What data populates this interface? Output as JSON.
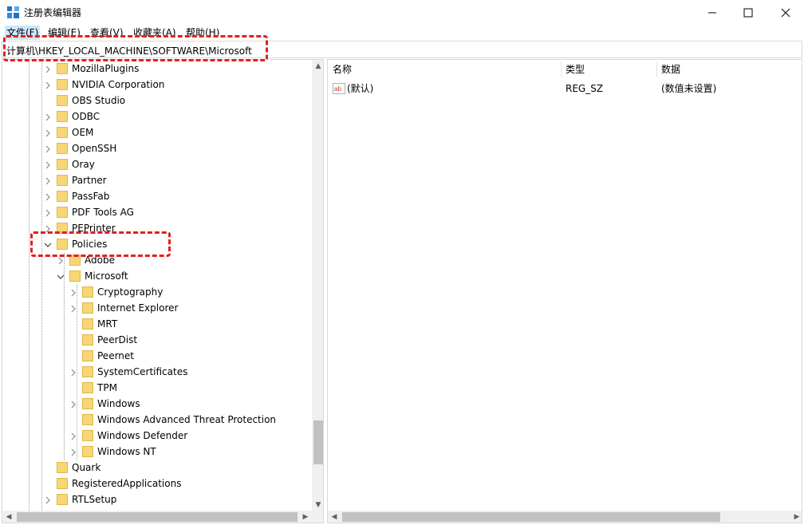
{
  "window": {
    "title": "注册表编辑器",
    "minimize_icon": "minimize-icon",
    "maximize_icon": "maximize-icon",
    "close_icon": "close-icon"
  },
  "menu": [
    "文件(F)",
    "编辑(E)",
    "查看(V)",
    "收藏夹(A)",
    "帮助(H)"
  ],
  "address": "计算机\\HKEY_LOCAL_MACHINE\\SOFTWARE\\Microsoft",
  "tree": [
    {
      "label": "MozillaPlugins",
      "expander": "collapsed"
    },
    {
      "label": "NVIDIA Corporation",
      "expander": "collapsed"
    },
    {
      "label": "OBS Studio",
      "expander": "none"
    },
    {
      "label": "ODBC",
      "expander": "collapsed"
    },
    {
      "label": "OEM",
      "expander": "collapsed"
    },
    {
      "label": "OpenSSH",
      "expander": "collapsed"
    },
    {
      "label": "Oray",
      "expander": "collapsed"
    },
    {
      "label": "Partner",
      "expander": "collapsed"
    },
    {
      "label": "PassFab",
      "expander": "collapsed"
    },
    {
      "label": "PDF Tools AG",
      "expander": "collapsed"
    },
    {
      "label": "PEPrinter",
      "expander": "collapsed"
    },
    {
      "label": "Policies",
      "expander": "expanded"
    },
    {
      "label": "Adobe",
      "expander": "collapsed"
    },
    {
      "label": "Microsoft",
      "expander": "expanded"
    },
    {
      "label": "Cryptography",
      "expander": "collapsed"
    },
    {
      "label": "Internet Explorer",
      "expander": "collapsed"
    },
    {
      "label": "MRT",
      "expander": "none"
    },
    {
      "label": "PeerDist",
      "expander": "none"
    },
    {
      "label": "Peernet",
      "expander": "none"
    },
    {
      "label": "SystemCertificates",
      "expander": "collapsed"
    },
    {
      "label": "TPM",
      "expander": "none"
    },
    {
      "label": "Windows",
      "expander": "collapsed"
    },
    {
      "label": "Windows Advanced Threat Protection",
      "expander": "none"
    },
    {
      "label": "Windows Defender",
      "expander": "collapsed"
    },
    {
      "label": "Windows NT",
      "expander": "collapsed"
    },
    {
      "label": "Quark",
      "expander": "none"
    },
    {
      "label": "RegisteredApplications",
      "expander": "none"
    },
    {
      "label": "RTLSetup",
      "expander": "collapsed"
    }
  ],
  "list": {
    "columns": [
      "名称",
      "类型",
      "数据"
    ],
    "rows": [
      {
        "name": "(默认)",
        "type": "REG_SZ",
        "data": "(数值未设置)",
        "icon": "string-value-icon",
        "icon_text": "ab"
      }
    ]
  },
  "colors": {
    "highlight_dash": "#e02020",
    "folder": "#f8d675",
    "menu_active": "#cce8ff"
  }
}
